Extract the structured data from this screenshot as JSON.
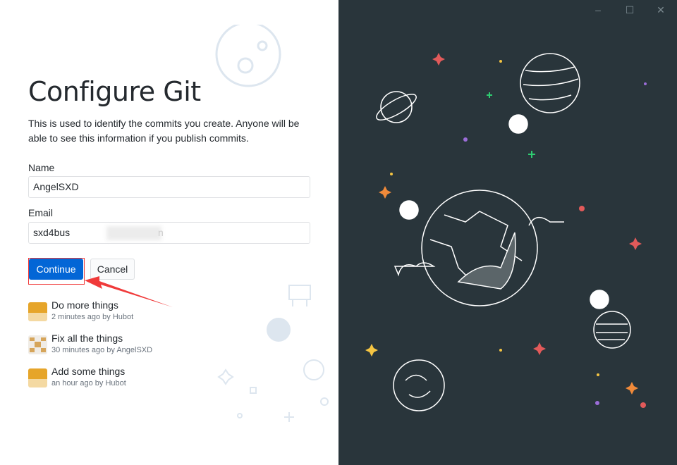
{
  "title": "Configure Git",
  "description": "This is used to identify the commits you create. Anyone will be able to see this information if you publish commits.",
  "form": {
    "name_label": "Name",
    "name_value": "AngelSXD",
    "email_label": "Email",
    "email_value": "sxd4bus",
    "email_suffix": "n"
  },
  "buttons": {
    "continue": "Continue",
    "cancel": "Cancel"
  },
  "commits": [
    {
      "title": "Do more things",
      "meta": "2 minutes ago by Hubot",
      "avatar": "hubot"
    },
    {
      "title": "Fix all the things",
      "meta": "30 minutes ago by AngelSXD",
      "avatar": "identicon"
    },
    {
      "title": "Add some things",
      "meta": "an hour ago by Hubot",
      "avatar": "hubot"
    }
  ],
  "window_controls": {
    "minimize": "–",
    "maximize": "☐",
    "close": "✕"
  },
  "colors": {
    "accent": "#0366d6",
    "annotation": "#f03a3a",
    "panel": "#29353b"
  }
}
